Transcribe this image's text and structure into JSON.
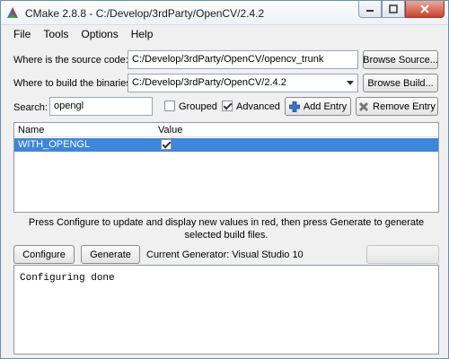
{
  "window": {
    "title": "CMake 2.8.8 - C:/Develop/3rdParty/OpenCV/2.4.2"
  },
  "menu": [
    "File",
    "Tools",
    "Options",
    "Help"
  ],
  "source": {
    "label": "Where is the source code:",
    "value": "C:/Develop/3rdParty/OpenCV/opencv_trunk",
    "button": "Browse Source..."
  },
  "build": {
    "label": "Where to build the binaries:",
    "value": "C:/Develop/3rdParty/OpenCV/2.4.2",
    "button": "Browse Build..."
  },
  "search": {
    "label": "Search:",
    "value": "opengl"
  },
  "options": {
    "grouped_label": "Grouped",
    "grouped_checked": false,
    "advanced_label": "Advanced",
    "advanced_checked": true
  },
  "entry_buttons": {
    "add": "Add Entry",
    "remove": "Remove Entry"
  },
  "table": {
    "columns": [
      "Name",
      "Value"
    ],
    "rows": [
      {
        "name": "WITH_OPENGL",
        "checked": true
      }
    ]
  },
  "hint": "Press Configure to update and display new values in red, then press Generate to generate selected build files.",
  "actions": {
    "configure": "Configure",
    "generate": "Generate",
    "generator_label": "Current Generator: Visual Studio 10"
  },
  "output": {
    "text": "Configuring done"
  },
  "colors": {
    "selection": "#3d86d9",
    "close_button": "#c7432b"
  }
}
